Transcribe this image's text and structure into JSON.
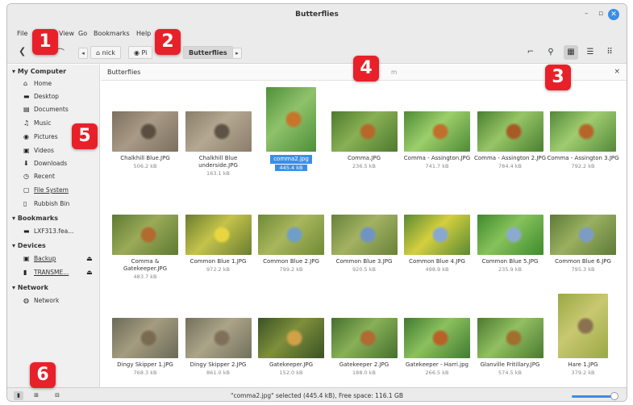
{
  "window": {
    "title": "Butterflies",
    "minimize": "–",
    "maximize": "▫",
    "close": "✕"
  },
  "menu": {
    "file": "File",
    "view": "View",
    "go": "Go",
    "bookmarks": "Bookmarks",
    "help": "Help"
  },
  "toolbar": {
    "back": "❮",
    "up": "⌒",
    "crumbs": [
      {
        "label": "nick",
        "icon": "home-icon"
      },
      {
        "label": "Pi",
        "icon": "camera-icon"
      },
      {
        "label": "Butterflies",
        "icon": ""
      }
    ],
    "crumb_left": "◂",
    "crumb_right": "▸",
    "terminal": "⌐",
    "search": "⚲",
    "view_icons": "▦",
    "view_list": "☰",
    "view_compact": "⠿"
  },
  "sidebar": {
    "sections": [
      {
        "title": "My Computer",
        "items": [
          {
            "label": "Home",
            "icon": "⌂"
          },
          {
            "label": "Desktop",
            "icon": "▬"
          },
          {
            "label": "Documents",
            "icon": "▤"
          },
          {
            "label": "Music",
            "icon": "♫"
          },
          {
            "label": "Pictures",
            "icon": "◉"
          },
          {
            "label": "Videos",
            "icon": "▣"
          },
          {
            "label": "Downloads",
            "icon": "⬇"
          },
          {
            "label": "Recent",
            "icon": "◷"
          },
          {
            "label": "File System",
            "icon": "▢"
          },
          {
            "label": "Rubbish Bin",
            "icon": "▯"
          }
        ]
      },
      {
        "title": "Bookmarks",
        "items": [
          {
            "label": "LXF313.fea...",
            "icon": "▬"
          }
        ]
      },
      {
        "title": "Devices",
        "items": [
          {
            "label": "Backup",
            "icon": "▣",
            "eject": "⏏"
          },
          {
            "label": "TRANSME...",
            "icon": "▮",
            "eject": "⏏"
          }
        ]
      },
      {
        "title": "Network",
        "items": [
          {
            "label": "Network",
            "icon": "◍"
          }
        ]
      }
    ]
  },
  "location": {
    "label": "Butterflies",
    "hint": "m",
    "close": "×"
  },
  "files": [
    {
      "name": "Chalkhill Blue.JPG",
      "size": "506.2 kB",
      "colors": [
        "#7d6f5e",
        "#a89a86",
        "#5a4e40"
      ]
    },
    {
      "name": "Chalkhill Blue underside.JPG",
      "size": "163.1 kB",
      "colors": [
        "#8a7d6a",
        "#b5a892",
        "#5e5344"
      ]
    },
    {
      "name": "comma2.jpg",
      "size": "445.4 kB",
      "colors": [
        "#4f8f3a",
        "#8fc26a",
        "#c7752a"
      ],
      "selected": true
    },
    {
      "name": "Comma.JPG",
      "size": "236.5 kB",
      "colors": [
        "#4d7a2e",
        "#88b054",
        "#b8672a"
      ]
    },
    {
      "name": "Comma - Assington.JPG",
      "size": "741.7 kB",
      "colors": [
        "#4f8a36",
        "#9ccf6b",
        "#c0702c"
      ]
    },
    {
      "name": "Comma - Assington 2.JPG",
      "size": "784.4 kB",
      "colors": [
        "#4a8031",
        "#97c466",
        "#a85a26"
      ]
    },
    {
      "name": "Comma - Assington 3.JPG",
      "size": "792.2 kB",
      "colors": [
        "#54893a",
        "#a0cc70",
        "#b6652a"
      ]
    },
    {
      "name": "Comma & Gatekeeper.JPG",
      "size": "483.7 kB",
      "colors": [
        "#5d7a32",
        "#9aaa58",
        "#b26a2e"
      ]
    },
    {
      "name": "Common Blue 1.JPG",
      "size": "972.2 kB",
      "colors": [
        "#6b7d30",
        "#c4c34a",
        "#e8d640"
      ]
    },
    {
      "name": "Common Blue 2.JPG",
      "size": "799.2 kB",
      "colors": [
        "#6f8a36",
        "#a9b65c",
        "#6f9ec8"
      ]
    },
    {
      "name": "Common Blue 3.JPG",
      "size": "920.5 kB",
      "colors": [
        "#67823a",
        "#a3b262",
        "#6f94c4"
      ]
    },
    {
      "name": "Common Blue 4.JPG",
      "size": "498.9 kB",
      "colors": [
        "#5a8a33",
        "#d4cf3e",
        "#88a8d0"
      ]
    },
    {
      "name": "Common Blue 5.JPG",
      "size": "235.9 kB",
      "colors": [
        "#3f8a2e",
        "#86c25a",
        "#8ca9cf"
      ]
    },
    {
      "name": "Common Blue 6.JPG",
      "size": "795.3 kB",
      "colors": [
        "#5d7a38",
        "#9ab060",
        "#7c9cc4"
      ]
    },
    {
      "name": "Dingy Skipper 1.JPG",
      "size": "768.3 kB",
      "colors": [
        "#6a6a58",
        "#a49c80",
        "#7a6a50"
      ]
    },
    {
      "name": "Dingy Skipper 2.JPG",
      "size": "861.0 kB",
      "colors": [
        "#72705c",
        "#aba488",
        "#80705a"
      ]
    },
    {
      "name": "Gatekeeper.JPG",
      "size": "152.0 kB",
      "colors": [
        "#3a5224",
        "#7e8f3c",
        "#d2a046"
      ]
    },
    {
      "name": "Gatekeeper 2.JPG",
      "size": "188.0 kB",
      "colors": [
        "#45702e",
        "#88b058",
        "#b06a32"
      ]
    },
    {
      "name": "Gatekeeper - Harri.jpg",
      "size": "266.5 kB",
      "colors": [
        "#3f7a30",
        "#8cc05e",
        "#b86228"
      ]
    },
    {
      "name": "Glanville Fritillary.JPG",
      "size": "574.5 kB",
      "colors": [
        "#4a7a30",
        "#92bf62",
        "#a0702e"
      ]
    },
    {
      "name": "Hare 1.JPG",
      "size": "379.2 kB",
      "colors": [
        "#9aa846",
        "#c8c870",
        "#8a7250"
      ],
      "tall": true
    }
  ],
  "status": {
    "text": "\"comma2.jpg\" selected (445.4 kB), Free space: 116.1 GB"
  },
  "statusbar_buttons": {
    "places": "▮",
    "tree": "⊞",
    "hide": "⊟"
  },
  "badges": [
    "1",
    "2",
    "3",
    "4",
    "5",
    "6"
  ],
  "accent": "#3b8ee6",
  "badge_color": "#e8202a"
}
